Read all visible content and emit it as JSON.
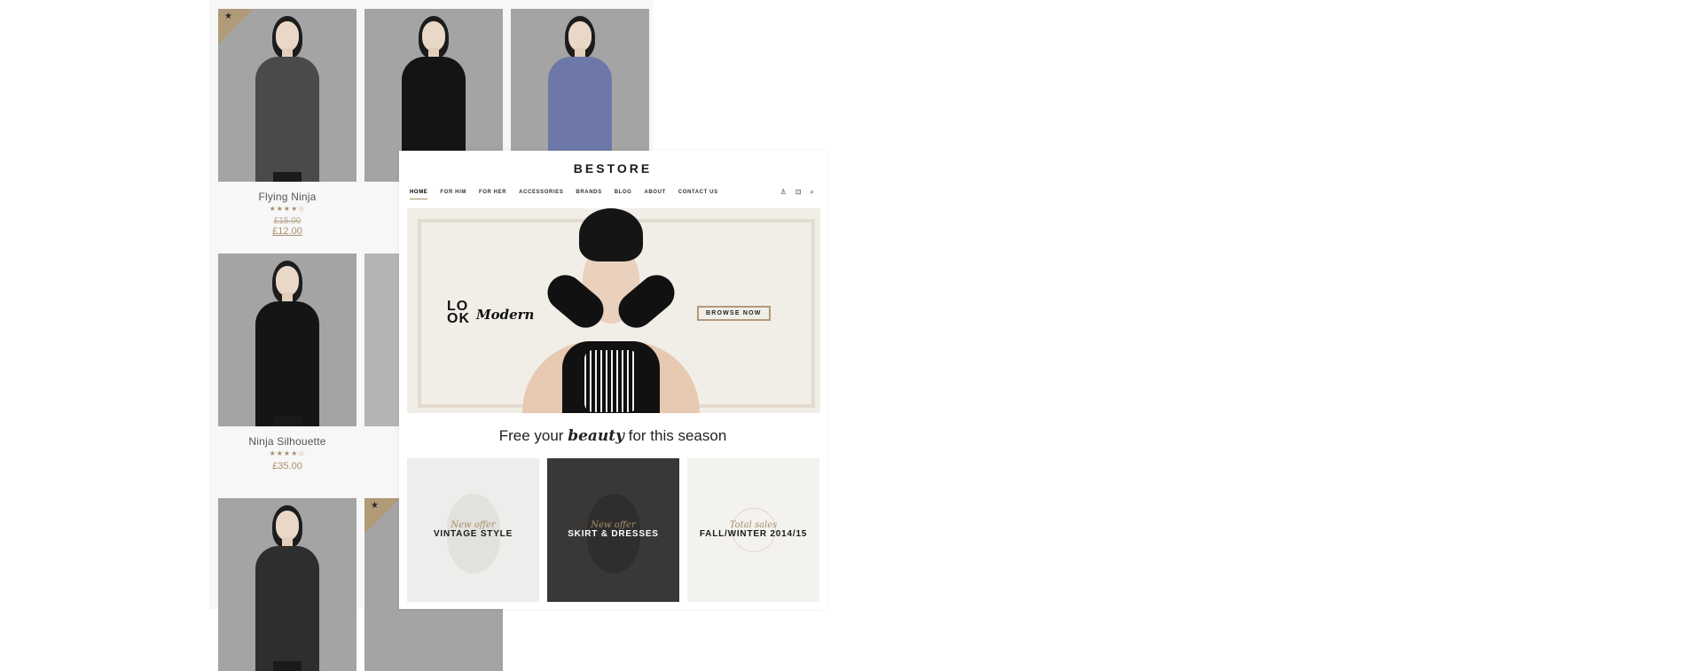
{
  "product_grid": {
    "products": [
      {
        "name": "Flying Ninja",
        "rating": "★★★★☆",
        "old_price": "£15.00",
        "price": "£12.00",
        "sale": true,
        "badge": "★"
      },
      {
        "name": "",
        "rating": "",
        "old_price": "",
        "price": "",
        "sale": false,
        "badge": ""
      },
      {
        "name": "",
        "rating": "",
        "old_price": "",
        "price": "",
        "sale": false,
        "badge": ""
      },
      {
        "name": "Ninja Silhouette",
        "rating": "★★★★☆",
        "old_price": "",
        "price": "£35.00",
        "sale": false,
        "badge": ""
      },
      {
        "name": "",
        "rating": "",
        "old_price": "",
        "price": "",
        "sale": false,
        "badge": ""
      },
      {
        "name": "",
        "rating": "",
        "old_price": "",
        "price": "",
        "sale": false,
        "badge": ""
      },
      {
        "name": "",
        "rating": "",
        "old_price": "",
        "price": "",
        "sale": false,
        "badge": "★"
      }
    ],
    "accent_color": "#a88e6a"
  },
  "store": {
    "logo": "BESTORE",
    "nav": [
      "HOME",
      "FOR HIM",
      "FOR HER",
      "ACCESSORIES",
      "BRANDS",
      "BLOG",
      "ABOUT",
      "CONTACT US"
    ],
    "nav_active": "HOME",
    "icons": [
      "user-icon",
      "cart-icon",
      "search-icon"
    ],
    "icon_glyphs": {
      "user": "♙",
      "cart": "⊡",
      "search": "⌕"
    },
    "hero": {
      "look_line1": "LO",
      "look_line2": "OK",
      "modern": "Modern",
      "button": "BROWSE NOW"
    },
    "tagline": {
      "before": "Free your ",
      "emphasis": "beauty",
      "after": " for this season"
    },
    "offers": [
      {
        "kicker": "New offer",
        "title": "VINTAGE STYLE"
      },
      {
        "kicker": "New offer",
        "title": "SKIRT & DRESSES"
      },
      {
        "kicker": "Total sales",
        "title": "FALL/WINTER 2014/15"
      }
    ]
  }
}
